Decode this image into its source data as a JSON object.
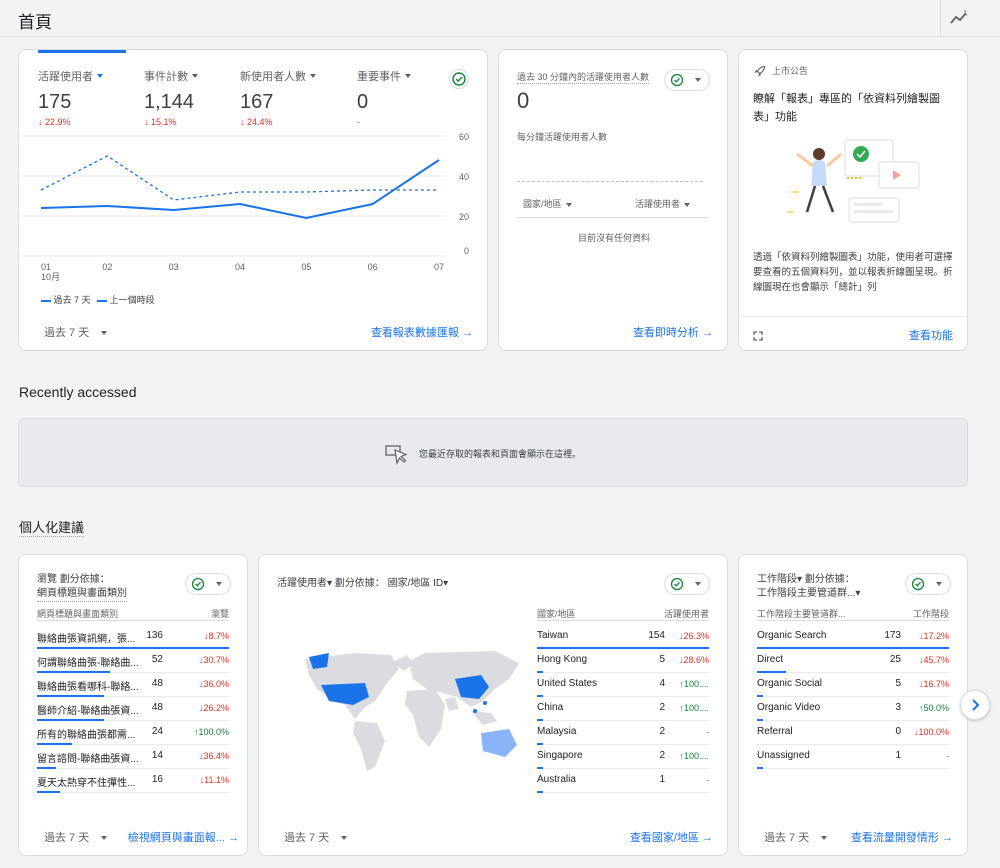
{
  "header": {
    "title": "首頁"
  },
  "overview": {
    "metrics": [
      {
        "label": "活躍使用者",
        "value": "175",
        "delta": "22.9%",
        "dir": "down"
      },
      {
        "label": "事件計數",
        "value": "1,144",
        "delta": "15.1%",
        "dir": "down"
      },
      {
        "label": "新使用者人數",
        "value": "167",
        "delta": "24.4%",
        "dir": "down"
      },
      {
        "label": "重要事件",
        "value": "0",
        "delta": "-",
        "dir": "none"
      }
    ],
    "chart_data": {
      "type": "line",
      "x": [
        "01",
        "02",
        "03",
        "04",
        "05",
        "06",
        "07"
      ],
      "x_sublabel": "10月",
      "ylim": [
        0,
        60
      ],
      "yticks": [
        "60",
        "40",
        "20",
        "0"
      ],
      "series": [
        {
          "name": "過去 7 天",
          "values": [
            24,
            25,
            23,
            26,
            19,
            26,
            48
          ],
          "style": "solid"
        },
        {
          "name": "上一個時段",
          "values": [
            33,
            50,
            28,
            32,
            32,
            33,
            33
          ],
          "style": "dashed"
        }
      ]
    },
    "range": "過去 7 天",
    "link": "查看報表數據匯報"
  },
  "realtime": {
    "title": "過去 30 分鐘內的活躍使用者人數",
    "value": "0",
    "sub": "每分鐘活躍使用者人數",
    "col1": "國家/地區",
    "col2": "活躍使用者",
    "empty": "目前沒有任何資料",
    "link": "查看即時分析"
  },
  "announce": {
    "tag": "上市公告",
    "title": "瞭解「報表」專區的「依資料列繪製圖表」功能",
    "body": "透過「依資料列繪製圖表」功能，使用者可選擇要查看的五個資料列，並以報表折線圖呈現。折線圖現在也會顯示「總計」列",
    "link": "查看功能"
  },
  "recent": {
    "heading": "Recently accessed",
    "message": "您最近存取的報表和頁面會顯示在這裡。"
  },
  "personal": {
    "heading": "個人化建議",
    "pages": {
      "title1": "瀏覽 劃分依據：",
      "title2": "網頁標題與畫面類別",
      "col1": "網頁標題與畫面類別",
      "col2": "瀏覽",
      "rows": [
        {
          "label": "聯絡曲張資訊網，張...",
          "value": "136",
          "delta": "8.7%",
          "dir": "down",
          "share": 1.0
        },
        {
          "label": "何謂聯絡曲張-聯絡曲...",
          "value": "52",
          "delta": "30.7%",
          "dir": "down",
          "share": 0.38
        },
        {
          "label": "聯絡曲張看哪科-聯絡...",
          "value": "48",
          "delta": "36.0%",
          "dir": "down",
          "share": 0.35
        },
        {
          "label": "醫師介紹-聯絡曲張資...",
          "value": "48",
          "delta": "26.2%",
          "dir": "down",
          "share": 0.35
        },
        {
          "label": "所有的聯絡曲張都需...",
          "value": "24",
          "delta": "100.0%",
          "dir": "up",
          "share": 0.18
        },
        {
          "label": "留言諮問-聯絡曲張資...",
          "value": "14",
          "delta": "36.4%",
          "dir": "down",
          "share": 0.1
        },
        {
          "label": "夏天太熱穿不住彈性...",
          "value": "16",
          "delta": "11.1%",
          "dir": "down",
          "share": 0.12
        }
      ],
      "range": "過去 7 天",
      "link": "檢視網頁與畫面報..."
    },
    "country": {
      "title": "活躍使用者▾ 劃分依據： 國家/地區 ID▾",
      "col1": "國家/地區",
      "col2": "活躍使用者",
      "rows": [
        {
          "label": "Taiwan",
          "value": "154",
          "delta": "26.3%",
          "dir": "down",
          "share": 1.0
        },
        {
          "label": "Hong Kong",
          "value": "5",
          "delta": "28.6%",
          "dir": "down",
          "share": 0.03
        },
        {
          "label": "United States",
          "value": "4",
          "delta": "100....",
          "dir": "up",
          "share": 0.03
        },
        {
          "label": "China",
          "value": "2",
          "delta": "100....",
          "dir": "up",
          "share": 0.02
        },
        {
          "label": "Malaysia",
          "value": "2",
          "delta": "-",
          "dir": "none",
          "share": 0.02
        },
        {
          "label": "Singapore",
          "value": "2",
          "delta": "100....",
          "dir": "up",
          "share": 0.02
        },
        {
          "label": "Australia",
          "value": "1",
          "delta": "-",
          "dir": "none",
          "share": 0.01
        }
      ],
      "range": "過去 7 天",
      "link": "查看國家/地區"
    },
    "channel": {
      "title1": "工作階段▾ 劃分依據：",
      "title2": "工作階段主要管道群...▾",
      "col1": "工作階段主要管道群...",
      "col2": "工作階段",
      "rows": [
        {
          "label": "Organic Search",
          "value": "173",
          "delta": "17.2%",
          "dir": "down",
          "share": 1.0
        },
        {
          "label": "Direct",
          "value": "25",
          "delta": "45.7%",
          "dir": "down",
          "share": 0.15
        },
        {
          "label": "Organic Social",
          "value": "5",
          "delta": "16.7%",
          "dir": "down",
          "share": 0.03
        },
        {
          "label": "Organic Video",
          "value": "3",
          "delta": "50.0%",
          "dir": "up",
          "share": 0.02
        },
        {
          "label": "Referral",
          "value": "0",
          "delta": "100.0%",
          "dir": "down",
          "share": 0.0
        },
        {
          "label": "Unassigned",
          "value": "1",
          "delta": "-",
          "dir": "none",
          "share": 0.01
        }
      ],
      "range": "過去 7 天",
      "link": "查看流量開發情形"
    }
  },
  "colors": {
    "accent": "#1a73e8",
    "down": "#d93025",
    "up": "#188038"
  }
}
